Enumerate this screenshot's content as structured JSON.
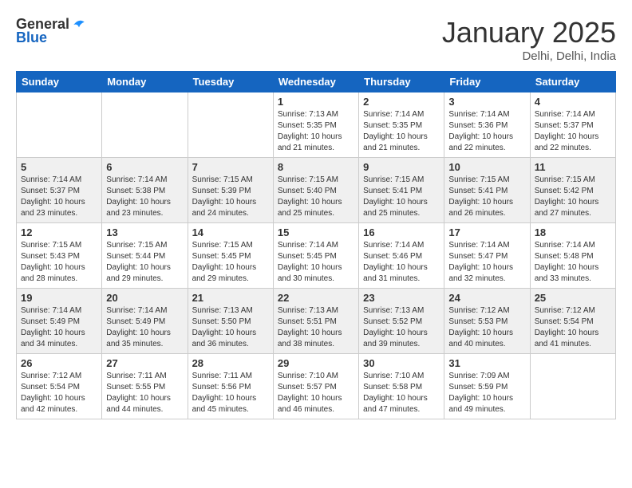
{
  "header": {
    "logo_general": "General",
    "logo_blue": "Blue",
    "month": "January 2025",
    "location": "Delhi, Delhi, India"
  },
  "days_of_week": [
    "Sunday",
    "Monday",
    "Tuesday",
    "Wednesday",
    "Thursday",
    "Friday",
    "Saturday"
  ],
  "weeks": [
    [
      {
        "num": "",
        "info": ""
      },
      {
        "num": "",
        "info": ""
      },
      {
        "num": "",
        "info": ""
      },
      {
        "num": "1",
        "info": "Sunrise: 7:13 AM\nSunset: 5:35 PM\nDaylight: 10 hours\nand 21 minutes."
      },
      {
        "num": "2",
        "info": "Sunrise: 7:14 AM\nSunset: 5:35 PM\nDaylight: 10 hours\nand 21 minutes."
      },
      {
        "num": "3",
        "info": "Sunrise: 7:14 AM\nSunset: 5:36 PM\nDaylight: 10 hours\nand 22 minutes."
      },
      {
        "num": "4",
        "info": "Sunrise: 7:14 AM\nSunset: 5:37 PM\nDaylight: 10 hours\nand 22 minutes."
      }
    ],
    [
      {
        "num": "5",
        "info": "Sunrise: 7:14 AM\nSunset: 5:37 PM\nDaylight: 10 hours\nand 23 minutes."
      },
      {
        "num": "6",
        "info": "Sunrise: 7:14 AM\nSunset: 5:38 PM\nDaylight: 10 hours\nand 23 minutes."
      },
      {
        "num": "7",
        "info": "Sunrise: 7:15 AM\nSunset: 5:39 PM\nDaylight: 10 hours\nand 24 minutes."
      },
      {
        "num": "8",
        "info": "Sunrise: 7:15 AM\nSunset: 5:40 PM\nDaylight: 10 hours\nand 25 minutes."
      },
      {
        "num": "9",
        "info": "Sunrise: 7:15 AM\nSunset: 5:41 PM\nDaylight: 10 hours\nand 25 minutes."
      },
      {
        "num": "10",
        "info": "Sunrise: 7:15 AM\nSunset: 5:41 PM\nDaylight: 10 hours\nand 26 minutes."
      },
      {
        "num": "11",
        "info": "Sunrise: 7:15 AM\nSunset: 5:42 PM\nDaylight: 10 hours\nand 27 minutes."
      }
    ],
    [
      {
        "num": "12",
        "info": "Sunrise: 7:15 AM\nSunset: 5:43 PM\nDaylight: 10 hours\nand 28 minutes."
      },
      {
        "num": "13",
        "info": "Sunrise: 7:15 AM\nSunset: 5:44 PM\nDaylight: 10 hours\nand 29 minutes."
      },
      {
        "num": "14",
        "info": "Sunrise: 7:15 AM\nSunset: 5:45 PM\nDaylight: 10 hours\nand 29 minutes."
      },
      {
        "num": "15",
        "info": "Sunrise: 7:14 AM\nSunset: 5:45 PM\nDaylight: 10 hours\nand 30 minutes."
      },
      {
        "num": "16",
        "info": "Sunrise: 7:14 AM\nSunset: 5:46 PM\nDaylight: 10 hours\nand 31 minutes."
      },
      {
        "num": "17",
        "info": "Sunrise: 7:14 AM\nSunset: 5:47 PM\nDaylight: 10 hours\nand 32 minutes."
      },
      {
        "num": "18",
        "info": "Sunrise: 7:14 AM\nSunset: 5:48 PM\nDaylight: 10 hours\nand 33 minutes."
      }
    ],
    [
      {
        "num": "19",
        "info": "Sunrise: 7:14 AM\nSunset: 5:49 PM\nDaylight: 10 hours\nand 34 minutes."
      },
      {
        "num": "20",
        "info": "Sunrise: 7:14 AM\nSunset: 5:49 PM\nDaylight: 10 hours\nand 35 minutes."
      },
      {
        "num": "21",
        "info": "Sunrise: 7:13 AM\nSunset: 5:50 PM\nDaylight: 10 hours\nand 36 minutes."
      },
      {
        "num": "22",
        "info": "Sunrise: 7:13 AM\nSunset: 5:51 PM\nDaylight: 10 hours\nand 38 minutes."
      },
      {
        "num": "23",
        "info": "Sunrise: 7:13 AM\nSunset: 5:52 PM\nDaylight: 10 hours\nand 39 minutes."
      },
      {
        "num": "24",
        "info": "Sunrise: 7:12 AM\nSunset: 5:53 PM\nDaylight: 10 hours\nand 40 minutes."
      },
      {
        "num": "25",
        "info": "Sunrise: 7:12 AM\nSunset: 5:54 PM\nDaylight: 10 hours\nand 41 minutes."
      }
    ],
    [
      {
        "num": "26",
        "info": "Sunrise: 7:12 AM\nSunset: 5:54 PM\nDaylight: 10 hours\nand 42 minutes."
      },
      {
        "num": "27",
        "info": "Sunrise: 7:11 AM\nSunset: 5:55 PM\nDaylight: 10 hours\nand 44 minutes."
      },
      {
        "num": "28",
        "info": "Sunrise: 7:11 AM\nSunset: 5:56 PM\nDaylight: 10 hours\nand 45 minutes."
      },
      {
        "num": "29",
        "info": "Sunrise: 7:10 AM\nSunset: 5:57 PM\nDaylight: 10 hours\nand 46 minutes."
      },
      {
        "num": "30",
        "info": "Sunrise: 7:10 AM\nSunset: 5:58 PM\nDaylight: 10 hours\nand 47 minutes."
      },
      {
        "num": "31",
        "info": "Sunrise: 7:09 AM\nSunset: 5:59 PM\nDaylight: 10 hours\nand 49 minutes."
      },
      {
        "num": "",
        "info": ""
      }
    ]
  ]
}
